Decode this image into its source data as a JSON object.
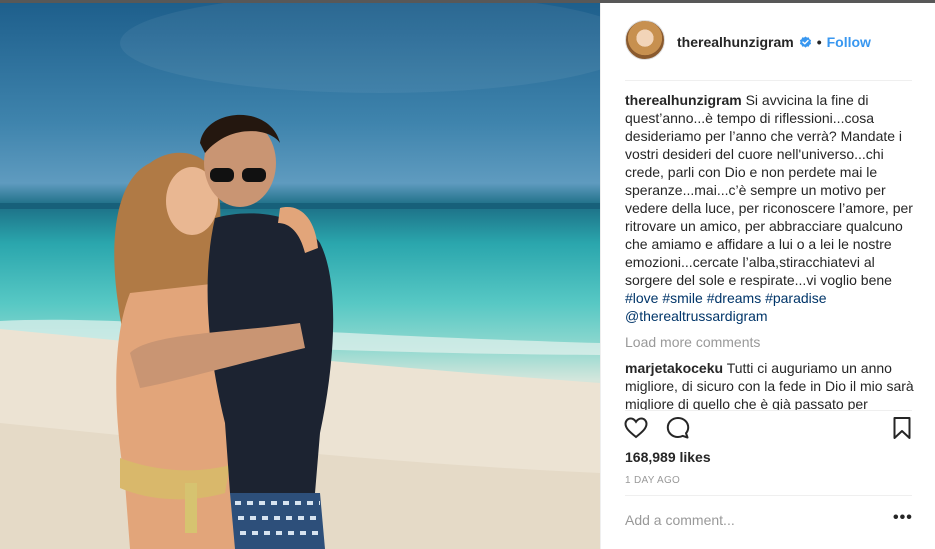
{
  "post": {
    "username": "therealhunzigram",
    "verified": true,
    "separator": "•",
    "follow_label": "Follow",
    "photo_alt": "Couple embracing on a tropical beach"
  },
  "caption": {
    "username": "therealhunzigram",
    "text": "Si avvicina la fine di quest’anno...è tempo di riflessioni...cosa desideriamo per l’anno che verrà? Mandate i vostri desideri del cuore nell'universo...chi crede, parli con Dio e non perdete mai le speranze...mai...c’è sempre un motivo per vedere della luce, per riconoscere l’amore, per ritrovare un amico, per abbracciare qualcuno che amiamo e affidare a lui o a lei le nostre emozioni...cercate l’alba,stiracchiatevi al sorgere del sole e respirate...vi voglio bene",
    "hashtags": [
      "#love",
      "#smile",
      "#dreams",
      "#paradise",
      "@therealtrussardigram"
    ]
  },
  "load_more_label": "Load more comments",
  "comments": [
    {
      "username": "marjetakoceku",
      "text": "Tutti ci auguriamo un anno migliore, di sicuro con la fede in Dio il mio sarà migliore di quello che è già passato per"
    }
  ],
  "likes": "168,989 likes",
  "timestamp": "1 DAY AGO",
  "add_comment_placeholder": "Add a comment...",
  "more_label": "•••",
  "icons": {
    "like": "heart-icon",
    "comment": "comment-bubble-icon",
    "save": "bookmark-icon",
    "verified": "verified-badge-icon"
  },
  "colors": {
    "link": "#003569",
    "follow": "#3897f0",
    "muted": "#999999",
    "text": "#262626"
  }
}
